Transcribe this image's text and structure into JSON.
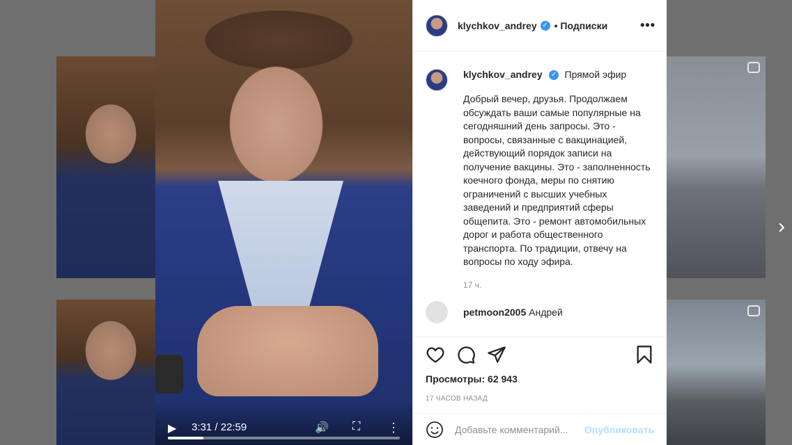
{
  "post": {
    "username": "klychkov_andrey",
    "verified_mark": "✓",
    "follow_label": "• Подписки",
    "more_label": "•••",
    "caption_title": "Прямой эфир",
    "caption_text": "Добрый вечер, друзья. Продолжаем обсуждать ваши самые популярные на сегодняшний день запросы. Это - вопросы, связанные с вакцинацией, действующий порядок записи на получение вакцины. Это - заполненность коечного фонда, меры по снятию ограничений с высших учебных заведений и предприятий сферы общепита. Это - ремонт автомобильных дорог и работа общественного транспорта. По традиции, отвечу на вопросы по ходу эфира.",
    "caption_time": "17 ч.",
    "next_comment_user": "petmoon2005",
    "next_comment_text": "Андрей",
    "views": "Просмотры: 62 943",
    "posted_ago": "17 ЧАСОВ НАЗАД",
    "comment_placeholder": "Добавьте комментарий...",
    "publish_label": "Опубликовать"
  },
  "video": {
    "time": "3:31 / 22:59",
    "progress": 0.153,
    "play_glyph": "▶",
    "volume_glyph": "🔊",
    "fullscreen_glyph": "⛶",
    "more_glyph": "⋮"
  },
  "nav": {
    "next_glyph": "›"
  },
  "colors": {
    "accent": "#3897f0",
    "publish_disabled": "#b2dffc",
    "muted": "#8e8e8e"
  }
}
